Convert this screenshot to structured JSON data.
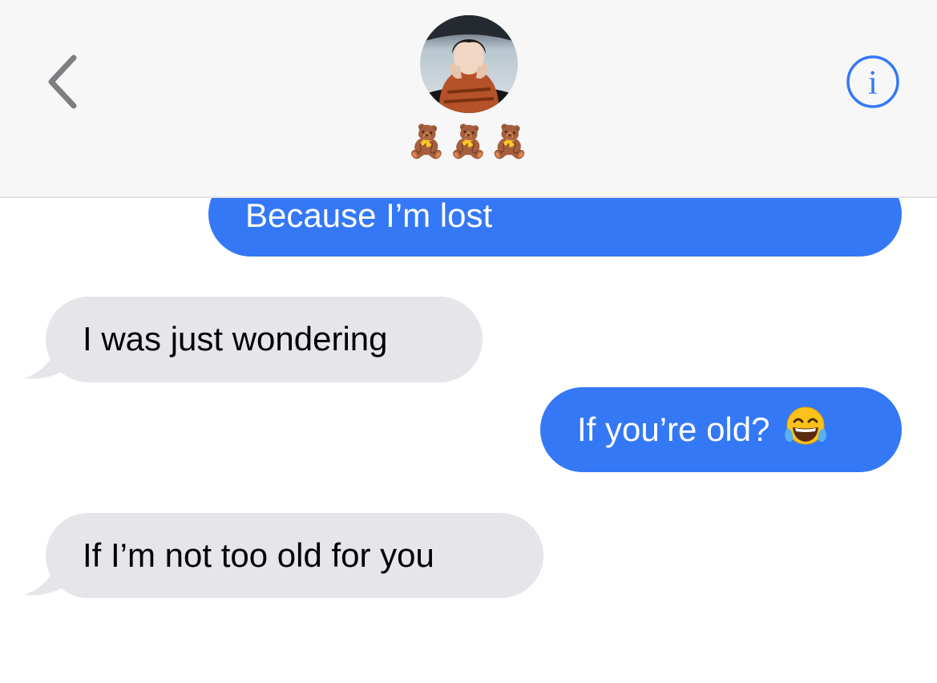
{
  "header": {
    "contact_name": "🧸🧸🧸",
    "back_icon": "chevron-left-icon",
    "info_icon": "info-circle-icon",
    "info_glyph": "i",
    "accent_color": "#3478f6"
  },
  "messages": [
    {
      "id": "m1",
      "direction": "sent",
      "text": "Because I’m lost"
    },
    {
      "id": "m2",
      "direction": "received",
      "text": "I was just wondering"
    },
    {
      "id": "m3",
      "direction": "sent",
      "text": "If you’re old?",
      "emoji": "😂"
    },
    {
      "id": "m4",
      "direction": "received",
      "text": "If I’m not too old for you"
    }
  ],
  "colors": {
    "sent_bubble": "#3478f6",
    "received_bubble": "#e5e5ea",
    "header_bg": "#f7f7f7"
  }
}
